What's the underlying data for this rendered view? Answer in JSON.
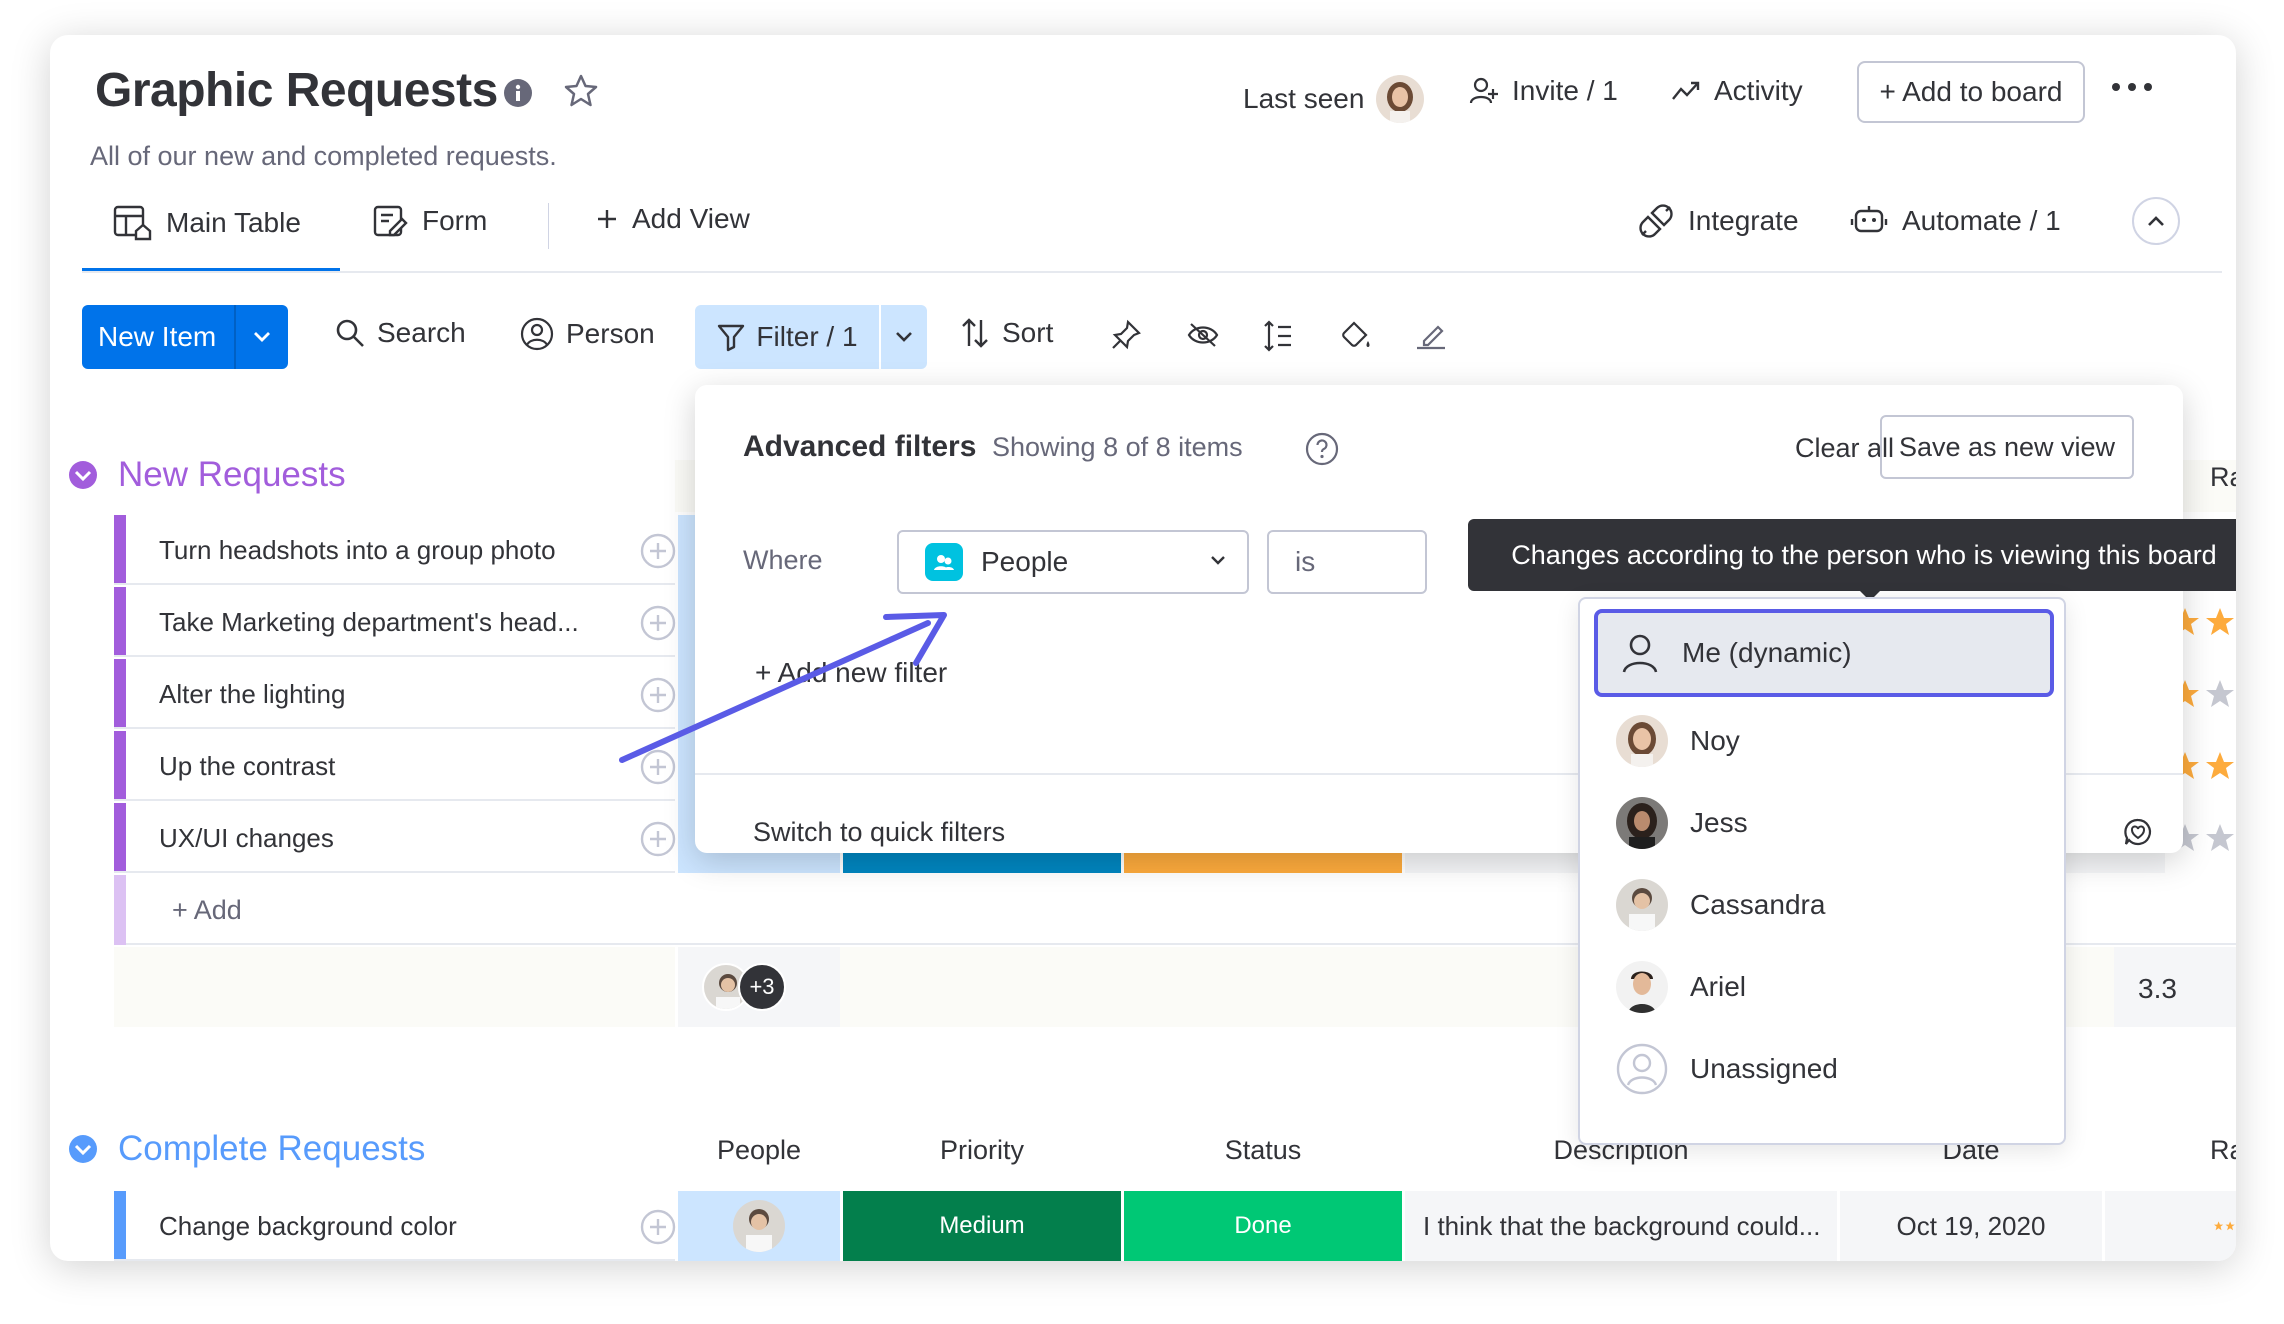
{
  "board": {
    "title": "Graphic Requests",
    "subtitle": "All of our new and completed requests.",
    "last_seen_label": "Last seen",
    "invite_label": "Invite / 1",
    "activity_label": "Activity",
    "add_to_board_label": "+ Add to board"
  },
  "views": {
    "main_table": "Main Table",
    "form": "Form",
    "add_view": "Add View",
    "integrate": "Integrate",
    "automate": "Automate / 1"
  },
  "toolbar": {
    "new_item": "New Item",
    "search": "Search",
    "person": "Person",
    "filter": "Filter / 1",
    "sort": "Sort"
  },
  "groups": {
    "new_requests": {
      "title": "New Requests",
      "items": [
        "Turn headshots into a group photo",
        "Take Marketing department's head...",
        "Alter the lighting",
        "Up the contrast",
        "UX/UI changes"
      ],
      "add_label": "+ Add",
      "people_summary_more": "+3",
      "rating_summary": "3.3"
    },
    "complete_requests": {
      "title": "Complete Requests",
      "columns": [
        "People",
        "Priority",
        "Status",
        "Description",
        "Date",
        "Ra"
      ],
      "rows": [
        {
          "name": "Change background color",
          "priority": "Medium",
          "status": "Done",
          "description": "I think that the background could...",
          "date": "Oct 19, 2020"
        }
      ]
    },
    "partial_rating_header": "Ra"
  },
  "advanced_filters": {
    "title": "Advanced filters",
    "count": "Showing 8 of 8 items",
    "clear_all": "Clear all",
    "save_view": "Save as new view",
    "where": "Where",
    "column_value": "People",
    "operator_value": "is",
    "add_filter": "+ Add new filter",
    "switch_quick": "Switch to quick filters"
  },
  "tooltip": {
    "text": "Changes according to the person who is viewing this board"
  },
  "people_dropdown": [
    {
      "name": "Me (dynamic)",
      "active": true
    },
    {
      "name": "Noy",
      "active": false
    },
    {
      "name": "Jess",
      "active": false
    },
    {
      "name": "Cassandra",
      "active": false
    },
    {
      "name": "Ariel",
      "active": false
    },
    {
      "name": "Unassigned",
      "active": false
    }
  ],
  "colors": {
    "primary": "#0073ea",
    "group_new": "#a25ddc",
    "group_complete": "#579bfc",
    "priority_medium": "#037f4c",
    "status_done": "#00c875",
    "highlight": "#5a5be6",
    "star": "#fdab3d"
  }
}
